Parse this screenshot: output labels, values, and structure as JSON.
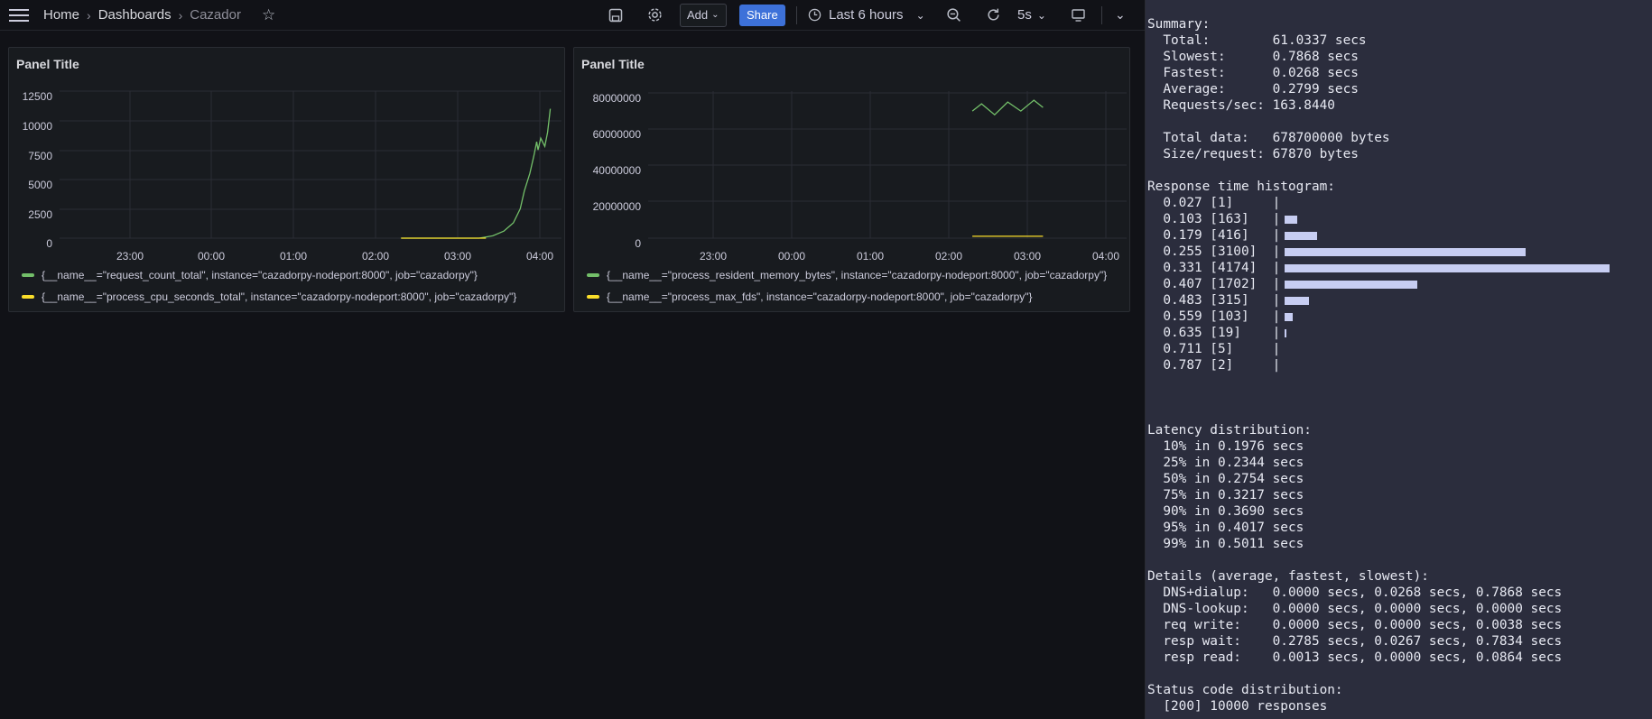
{
  "toolbar": {
    "breadcrumb": [
      "Home",
      "Dashboards",
      "Cazador"
    ],
    "add_label": "Add",
    "share_label": "Share",
    "time_range": "Last 6 hours",
    "refresh_interval": "5s"
  },
  "panels": [
    {
      "title": "Panel Title",
      "y_ticks": [
        "12500",
        "10000",
        "7500",
        "5000",
        "2500",
        "0"
      ],
      "x_ticks": [
        "23:00",
        "00:00",
        "01:00",
        "02:00",
        "03:00",
        "04:00"
      ],
      "legend": [
        {
          "text": "{__name__=\"request_count_total\", instance=\"cazadorpy-nodeport:8000\", job=\"cazadorpy\"}",
          "color": "#73bf69"
        },
        {
          "text": "{__name__=\"process_cpu_seconds_total\", instance=\"cazadorpy-nodeport:8000\", job=\"cazadorpy\"}",
          "color": "#fade2a"
        }
      ]
    },
    {
      "title": "Panel Title",
      "y_ticks": [
        "80000000",
        "60000000",
        "40000000",
        "20000000",
        "0"
      ],
      "x_ticks": [
        "23:00",
        "00:00",
        "01:00",
        "02:00",
        "03:00",
        "04:00"
      ],
      "legend": [
        {
          "text": "{__name__=\"process_resident_memory_bytes\", instance=\"cazadorpy-nodeport:8000\", job=\"cazadorpy\"}",
          "color": "#73bf69"
        },
        {
          "text": "{__name__=\"process_max_fds\", instance=\"cazadorpy-nodeport:8000\", job=\"cazadorpy\"}",
          "color": "#fade2a"
        }
      ]
    }
  ],
  "chart_data": [
    {
      "type": "line",
      "ylim": [
        0,
        12500
      ],
      "series": [
        {
          "name": "{__name__=\"request_count_total\", instance=\"cazadorpy-nodeport:8000\", job=\"cazadorpy\"}",
          "x": [
            "02:18",
            "03:00",
            "03:15",
            "03:25",
            "03:33",
            "03:40",
            "03:45",
            "03:48",
            "03:52",
            "03:55",
            "03:57",
            "03:58",
            "04:00",
            "04:03",
            "04:05",
            "04:07"
          ],
          "y": [
            0,
            0,
            0,
            200,
            600,
            1300,
            2500,
            4000,
            5500,
            7000,
            8200,
            7500,
            8500,
            7800,
            9000,
            11000
          ]
        },
        {
          "name": "{__name__=\"process_cpu_seconds_total\", instance=\"cazadorpy-nodeport:8000\", job=\"cazadorpy\"}",
          "x": [
            "02:18",
            "03:00",
            "03:20"
          ],
          "y": [
            0,
            0,
            0
          ]
        }
      ]
    },
    {
      "type": "line",
      "ylim": [
        0,
        80000000
      ],
      "series": [
        {
          "name": "{__name__=\"process_resident_memory_bytes\", instance=\"cazadorpy-nodeport:8000\", job=\"cazadorpy\"}",
          "x": [
            "02:18",
            "02:25",
            "02:35",
            "02:45",
            "02:55",
            "03:05",
            "03:12"
          ],
          "y": [
            70000000,
            74000000,
            68000000,
            75000000,
            70000000,
            76000000,
            72000000
          ]
        },
        {
          "name": "{__name__=\"process_max_fds\", instance=\"cazadorpy-nodeport:8000\", job=\"cazadorpy\"}",
          "x": [
            "02:18",
            "03:12"
          ],
          "y": [
            1048576,
            1048576
          ]
        }
      ]
    }
  ],
  "terminal": {
    "lines": [
      "Summary:",
      "  Total:        61.0337 secs",
      "  Slowest:      0.7868 secs",
      "  Fastest:      0.0268 secs",
      "  Average:      0.2799 secs",
      "  Requests/sec: 163.8440",
      "",
      "  Total data:   678700000 bytes",
      "  Size/request: 67870 bytes",
      "",
      "Response time histogram:",
      "  0.027 [1]     |",
      "  0.103 [163]   |",
      "  0.179 [416]   |",
      "  0.255 [3100]  |",
      "  0.331 [4174]  |",
      "  0.407 [1702]  |",
      "  0.483 [315]   |",
      "  0.559 [103]   |",
      "  0.635 [19]    |",
      "  0.711 [5]     |",
      "  0.787 [2]     |",
      "",
      "",
      "",
      "Latency distribution:",
      "  10% in 0.1976 secs",
      "  25% in 0.2344 secs",
      "  50% in 0.2754 secs",
      "  75% in 0.3217 secs",
      "  90% in 0.3690 secs",
      "  95% in 0.4017 secs",
      "  99% in 0.5011 secs",
      "",
      "Details (average, fastest, slowest):",
      "  DNS+dialup:   0.0000 secs, 0.0268 secs, 0.7868 secs",
      "  DNS-lookup:   0.0000 secs, 0.0000 secs, 0.0000 secs",
      "  req write:    0.0000 secs, 0.0000 secs, 0.0038 secs",
      "  resp wait:    0.2785 secs, 0.0267 secs, 0.7834 secs",
      "  resp read:    0.0013 secs, 0.0000 secs, 0.0864 secs",
      "",
      "Status code distribution:",
      "  [200] 10000 responses"
    ],
    "histogram_counts": [
      1,
      163,
      416,
      3100,
      4174,
      1702,
      315,
      103,
      19,
      5,
      2
    ]
  }
}
